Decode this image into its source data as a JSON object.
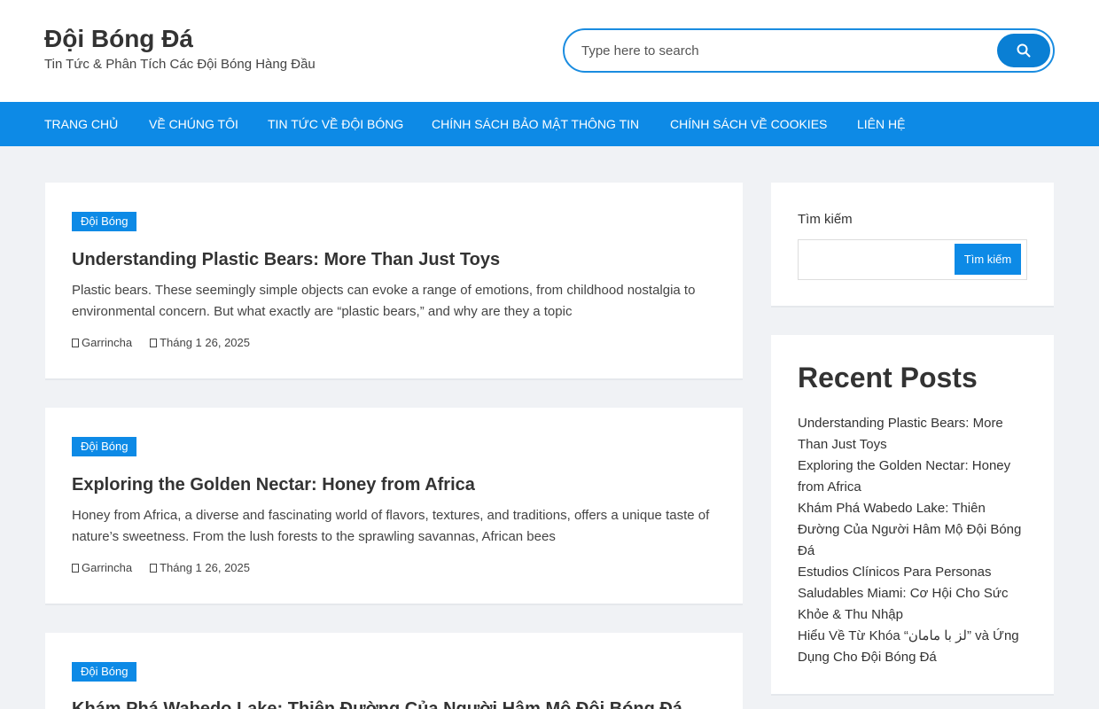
{
  "site": {
    "title": "Đội Bóng Đá",
    "tagline": "Tin Tức & Phân Tích Các Đội Bóng Hàng Đầu"
  },
  "search": {
    "placeholder": "Type here to search",
    "button_icon": "search-icon"
  },
  "nav": {
    "items": [
      {
        "label": "TRANG CHỦ"
      },
      {
        "label": "VỀ CHÚNG TÔI"
      },
      {
        "label": "TIN TỨC VỀ ĐỘI BÓNG"
      },
      {
        "label": "CHÍNH SÁCH BẢO MẬT THÔNG TIN"
      },
      {
        "label": "CHÍNH SÁCH VỀ COOKIES"
      },
      {
        "label": "LIÊN HỆ"
      }
    ]
  },
  "posts": [
    {
      "category": "Đội Bóng",
      "title": "Understanding Plastic Bears: More Than Just Toys",
      "excerpt": "Plastic bears. These seemingly simple objects can evoke a range of emotions, from childhood nostalgia to environmental concern. But what exactly are “plastic bears,” and why are they a topic",
      "author": "Garrincha",
      "date": "Tháng 1 26, 2025"
    },
    {
      "category": "Đội Bóng",
      "title": "Exploring the Golden Nectar: Honey from Africa",
      "excerpt": "Honey from Africa, a diverse and fascinating world of flavors, textures, and traditions, offers a unique taste of nature’s sweetness. From the lush forests to the sprawling savannas, African bees",
      "author": "Garrincha",
      "date": "Tháng 1 26, 2025"
    },
    {
      "category": "Đội Bóng",
      "title": "Khám Phá Wabedo Lake: Thiên Đường Của Người Hâm Mộ Đội Bóng Đá"
    }
  ],
  "sidebar": {
    "search_widget": {
      "label": "Tìm kiếm",
      "button": "Tìm kiếm"
    },
    "recent_posts": {
      "heading": "Recent Posts",
      "items": [
        "Understanding Plastic Bears: More Than Just Toys",
        "Exploring the Golden Nectar: Honey from Africa",
        "Khám Phá Wabedo Lake: Thiên Đường Của Người Hâm Mộ Đội Bóng Đá",
        "Estudios Clínicos Para Personas Saludables Miami: Cơ Hội Cho Sức Khỏe & Thu Nhập",
        "Hiểu Về Từ Khóa “لز با مامان” và Ứng Dụng Cho Đội Bóng Đá"
      ]
    }
  },
  "colors": {
    "accent": "#0d8ae6",
    "background": "#f0f2f5"
  }
}
